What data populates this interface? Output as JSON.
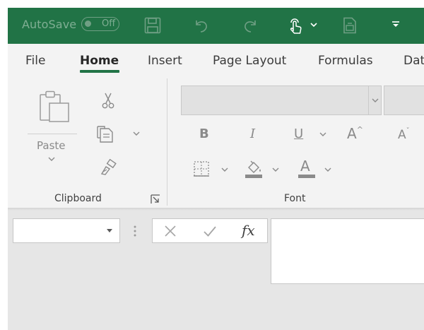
{
  "title_bar": {
    "autosave_label": "AutoSave",
    "autosave_state": "Off",
    "icons": [
      "save-icon",
      "undo-icon",
      "redo-icon",
      "touch-mode-icon",
      "chevron-down-icon",
      "print-preview-icon",
      "customize-qat-icon"
    ],
    "background": "#217346"
  },
  "tabs": [
    {
      "label": "File",
      "active": false
    },
    {
      "label": "Home",
      "active": true
    },
    {
      "label": "Insert",
      "active": false
    },
    {
      "label": "Page Layout",
      "active": false
    },
    {
      "label": "Formulas",
      "active": false
    },
    {
      "label": "Dat",
      "active": false
    }
  ],
  "ribbon": {
    "clipboard": {
      "label": "Clipboard",
      "paste_label": "Paste",
      "icons": [
        "paste-icon",
        "cut-icon",
        "copy-icon",
        "format-painter-icon",
        "dialog-launcher-icon"
      ]
    },
    "font": {
      "label": "Font",
      "font_name": "",
      "font_size": "",
      "bold_label": "B",
      "italic_label": "I",
      "underline_label": "U",
      "grow_label": "A",
      "shrink_label": "A",
      "font_color_label": "A",
      "icons": [
        "borders-icon",
        "fill-color-icon"
      ]
    }
  },
  "formula_bar": {
    "name_box_value": "",
    "cancel_icon": "close-icon",
    "enter_icon": "check-icon",
    "fx_label": "fx",
    "formula_value": ""
  }
}
